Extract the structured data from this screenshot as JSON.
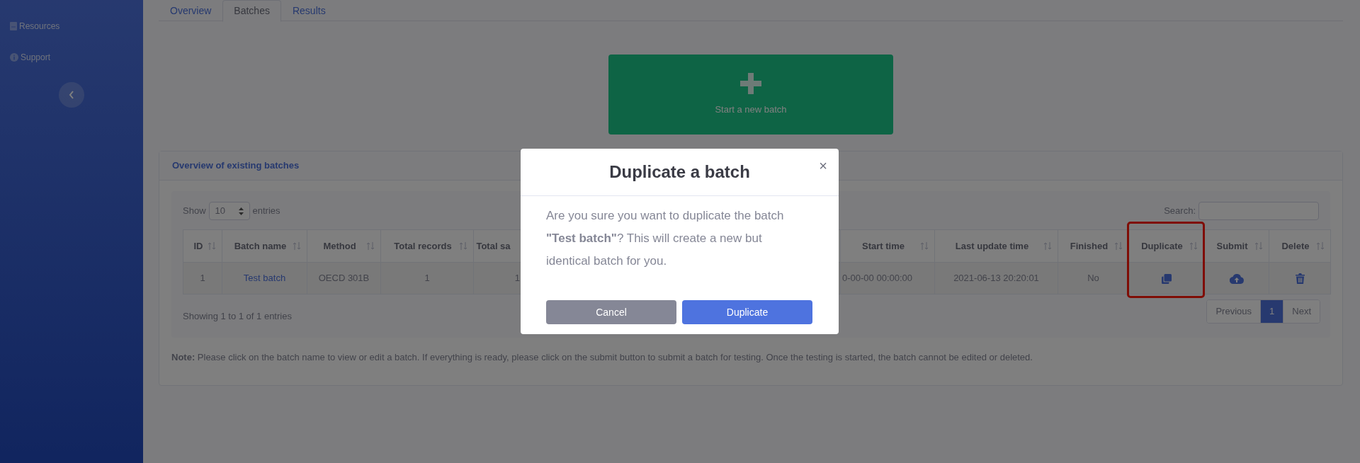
{
  "sidebar": {
    "items": [
      {
        "label": "Resources",
        "kind": "book"
      },
      {
        "label": "Support",
        "kind": "info"
      }
    ]
  },
  "tabs": [
    {
      "label": "Overview",
      "selected": false
    },
    {
      "label": "Batches",
      "selected": true
    },
    {
      "label": "Results",
      "selected": false
    }
  ],
  "new_batch_button": {
    "label": "Start a new batch"
  },
  "batches_card": {
    "title": "Overview of existing batches",
    "length_menu": {
      "prefix": "Show",
      "value": "10",
      "suffix": "entries"
    },
    "search": {
      "label": "Search:"
    },
    "table": {
      "columns": [
        {
          "label": "ID",
          "highlighted": false
        },
        {
          "label": "Batch name",
          "highlighted": false
        },
        {
          "label": "Method",
          "highlighted": false
        },
        {
          "label": "Total records",
          "highlighted": false
        },
        {
          "label": "Total sa",
          "highlighted": false
        },
        {
          "label": "Start time",
          "highlighted": false
        },
        {
          "label": "Last update time",
          "highlighted": false
        },
        {
          "label": "Finished",
          "highlighted": false
        },
        {
          "label": "Duplicate",
          "highlighted": true
        },
        {
          "label": "Submit",
          "highlighted": false
        },
        {
          "label": "Delete",
          "highlighted": false
        }
      ],
      "rows": [
        {
          "cells": [
            {
              "kind": "text",
              "text": "1"
            },
            {
              "kind": "link",
              "text": "Test batch"
            },
            {
              "kind": "text",
              "text": "OECD 301B"
            },
            {
              "kind": "text",
              "text": "1"
            },
            {
              "kind": "text",
              "text": "1"
            },
            {
              "kind": "text",
              "text": "0-00-00 00:00:00"
            },
            {
              "kind": "text",
              "text": "2021-06-13 20:20:01"
            },
            {
              "kind": "text",
              "text": "No"
            },
            {
              "kind": "duplicate"
            },
            {
              "kind": "submit"
            },
            {
              "kind": "delete"
            }
          ]
        }
      ]
    },
    "info": "Showing 1 to 1 of 1 entries",
    "pagination": [
      {
        "label": "Previous",
        "selected": false
      },
      {
        "label": "1",
        "selected": true
      },
      {
        "label": "Next",
        "selected": false
      }
    ],
    "note": "**Note:** Please click on the batch name to view or edit a batch. If everything is ready, please click on the submit button to submit a batch for testing. Once the testing is started, the batch cannot be edited or deleted."
  },
  "modal": {
    "title": "Duplicate a batch",
    "close": "×",
    "body": "Are you sure you want to duplicate the batch **\"Test batch\"**? This will create a new but identical batch for you.",
    "buttons": [
      {
        "label": "Cancel",
        "kind": "secondary"
      },
      {
        "label": "Duplicate",
        "kind": "primary"
      }
    ]
  }
}
